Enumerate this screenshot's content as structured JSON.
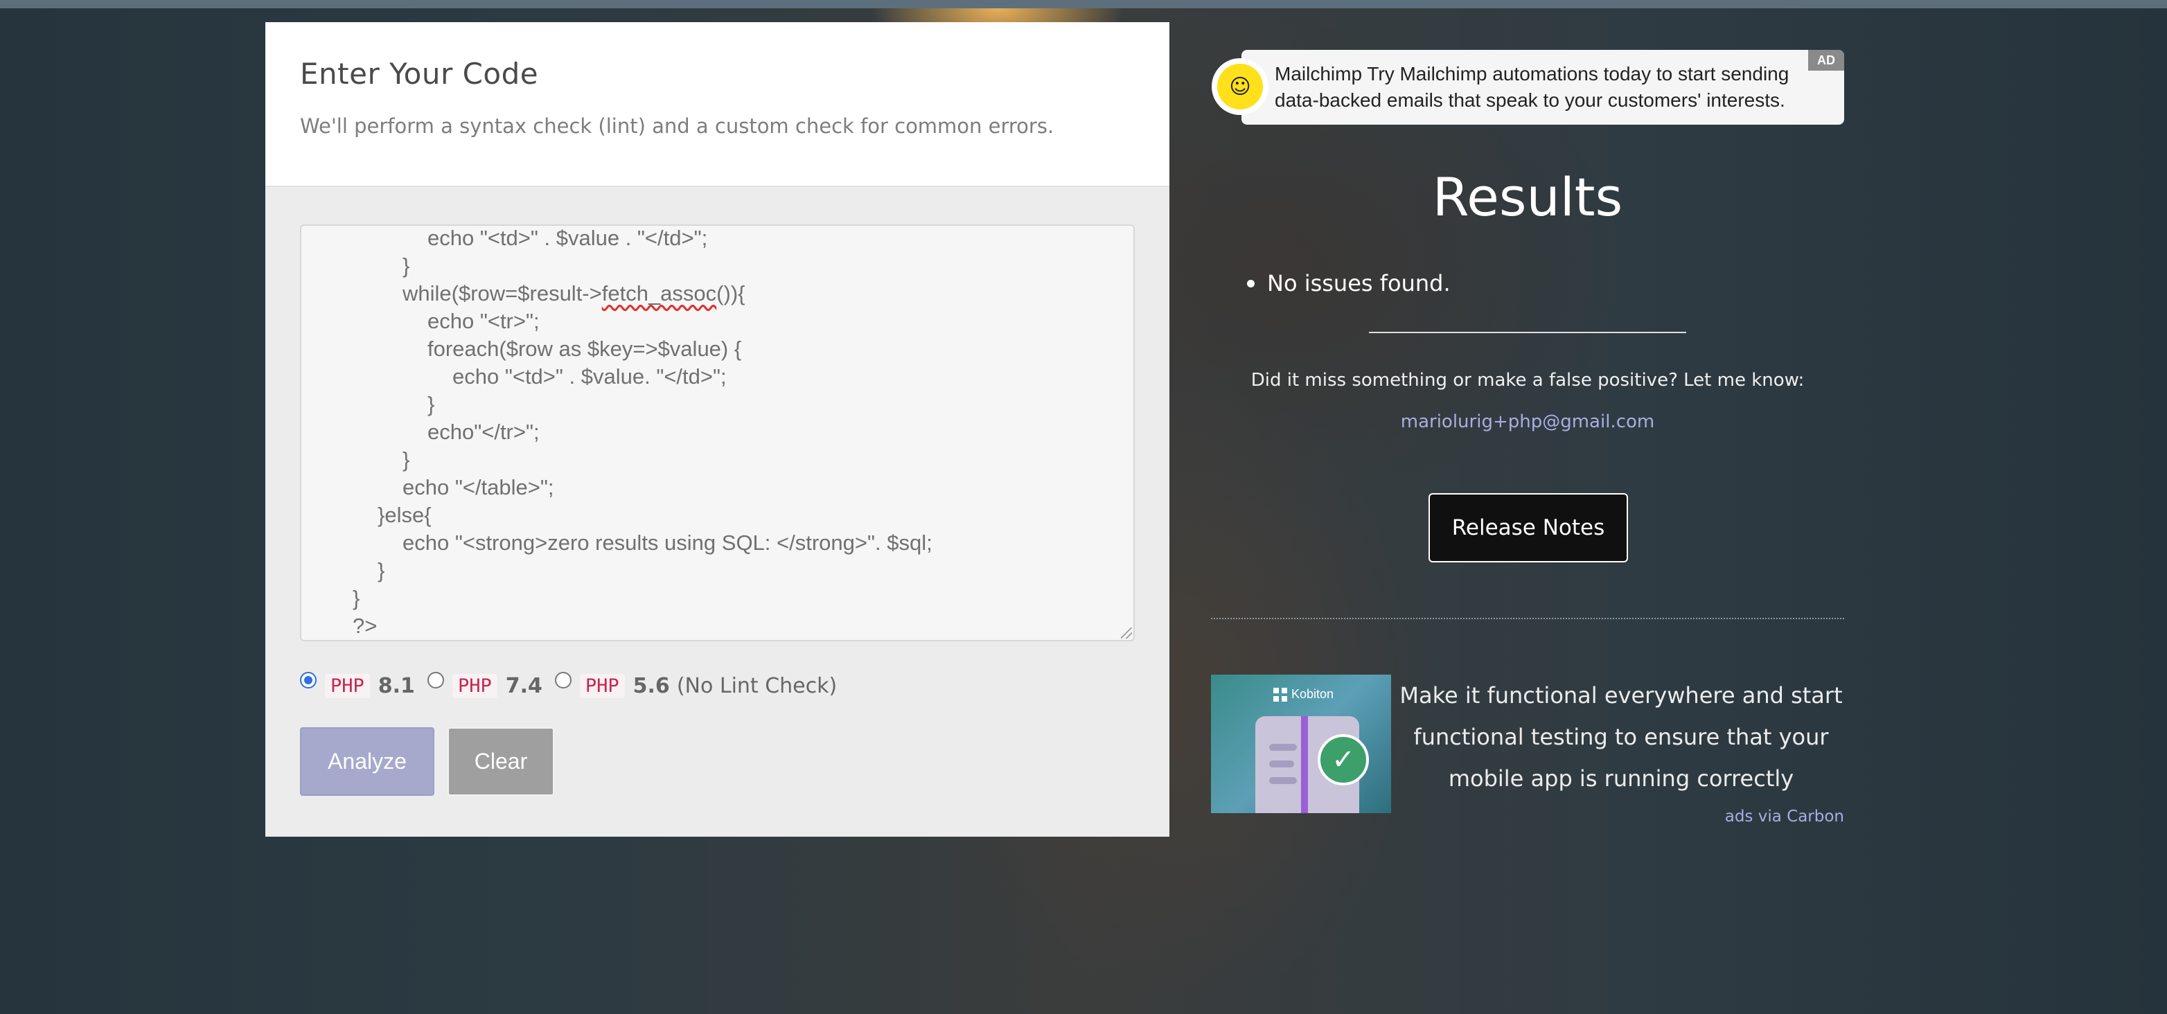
{
  "form": {
    "title": "Enter Your Code",
    "subtitle": "We'll perform a syntax check (lint) and a custom check for common errors.",
    "code_lines": [
      "echo \"<td>\" . $value . \"</td>\";",
      "}",
      "while($row=$result->",
      "fetch_assoc",
      "()){",
      "echo \"<tr>\";",
      "foreach($row as $key=>$value) {",
      "echo \"<td>\" . $value. \"</td>\";",
      "}",
      "echo\"</tr>\";",
      "}",
      "echo \"</table>\";",
      "}else{",
      "echo \"<strong>zero results using SQL: </strong>\". $sql;",
      "}",
      "}",
      "?>"
    ],
    "php_options": [
      {
        "badge": "PHP",
        "version": "8.1",
        "note": "",
        "selected": true
      },
      {
        "badge": "PHP",
        "version": "7.4",
        "note": "",
        "selected": false
      },
      {
        "badge": "PHP",
        "version": "5.6",
        "note": "(No Lint Check)",
        "selected": false
      }
    ],
    "analyze_label": "Analyze",
    "clear_label": "Clear"
  },
  "ad_top": {
    "text": "Mailchimp Try Mailchimp automations today to start sending data-backed emails that speak to your customers' interests.",
    "badge": "AD",
    "logo_icon": "mailchimp-logo-icon",
    "logo_color": "#ffe01b"
  },
  "results": {
    "title": "Results",
    "items": [
      "No issues found."
    ],
    "feedback": "Did it miss something or make a false positive? Let me know:",
    "email": "mariolurig+php@gmail.com",
    "release_notes_label": "Release Notes"
  },
  "carbon_ad": {
    "brand": "Kobiton",
    "text": "Make it functional everywhere and start functional testing to ensure that your mobile app is running correctly",
    "via": "ads via Carbon"
  },
  "colors": {
    "analyze_button": "#a6a8cc",
    "clear_button": "#9f9f9f",
    "php_badge": "#c7254e",
    "link": "#a8aee0"
  }
}
